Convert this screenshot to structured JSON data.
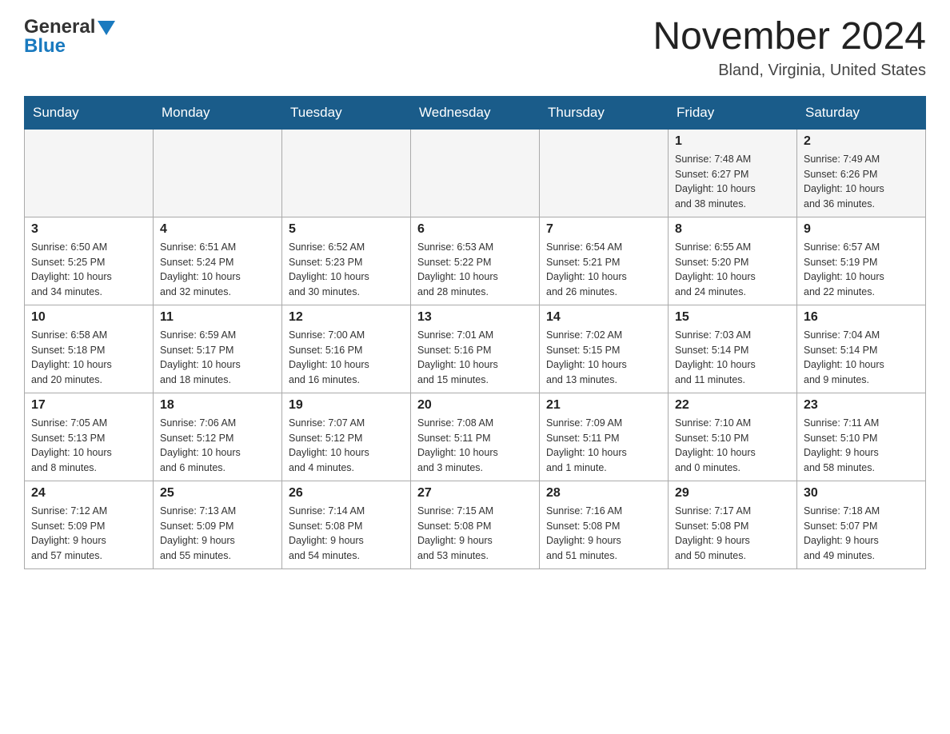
{
  "header": {
    "logo_line1": "General",
    "logo_line2": "Blue",
    "month_title": "November 2024",
    "location": "Bland, Virginia, United States"
  },
  "days_of_week": [
    "Sunday",
    "Monday",
    "Tuesday",
    "Wednesday",
    "Thursday",
    "Friday",
    "Saturday"
  ],
  "weeks": [
    [
      {
        "day": "",
        "info": ""
      },
      {
        "day": "",
        "info": ""
      },
      {
        "day": "",
        "info": ""
      },
      {
        "day": "",
        "info": ""
      },
      {
        "day": "",
        "info": ""
      },
      {
        "day": "1",
        "info": "Sunrise: 7:48 AM\nSunset: 6:27 PM\nDaylight: 10 hours\nand 38 minutes."
      },
      {
        "day": "2",
        "info": "Sunrise: 7:49 AM\nSunset: 6:26 PM\nDaylight: 10 hours\nand 36 minutes."
      }
    ],
    [
      {
        "day": "3",
        "info": "Sunrise: 6:50 AM\nSunset: 5:25 PM\nDaylight: 10 hours\nand 34 minutes."
      },
      {
        "day": "4",
        "info": "Sunrise: 6:51 AM\nSunset: 5:24 PM\nDaylight: 10 hours\nand 32 minutes."
      },
      {
        "day": "5",
        "info": "Sunrise: 6:52 AM\nSunset: 5:23 PM\nDaylight: 10 hours\nand 30 minutes."
      },
      {
        "day": "6",
        "info": "Sunrise: 6:53 AM\nSunset: 5:22 PM\nDaylight: 10 hours\nand 28 minutes."
      },
      {
        "day": "7",
        "info": "Sunrise: 6:54 AM\nSunset: 5:21 PM\nDaylight: 10 hours\nand 26 minutes."
      },
      {
        "day": "8",
        "info": "Sunrise: 6:55 AM\nSunset: 5:20 PM\nDaylight: 10 hours\nand 24 minutes."
      },
      {
        "day": "9",
        "info": "Sunrise: 6:57 AM\nSunset: 5:19 PM\nDaylight: 10 hours\nand 22 minutes."
      }
    ],
    [
      {
        "day": "10",
        "info": "Sunrise: 6:58 AM\nSunset: 5:18 PM\nDaylight: 10 hours\nand 20 minutes."
      },
      {
        "day": "11",
        "info": "Sunrise: 6:59 AM\nSunset: 5:17 PM\nDaylight: 10 hours\nand 18 minutes."
      },
      {
        "day": "12",
        "info": "Sunrise: 7:00 AM\nSunset: 5:16 PM\nDaylight: 10 hours\nand 16 minutes."
      },
      {
        "day": "13",
        "info": "Sunrise: 7:01 AM\nSunset: 5:16 PM\nDaylight: 10 hours\nand 15 minutes."
      },
      {
        "day": "14",
        "info": "Sunrise: 7:02 AM\nSunset: 5:15 PM\nDaylight: 10 hours\nand 13 minutes."
      },
      {
        "day": "15",
        "info": "Sunrise: 7:03 AM\nSunset: 5:14 PM\nDaylight: 10 hours\nand 11 minutes."
      },
      {
        "day": "16",
        "info": "Sunrise: 7:04 AM\nSunset: 5:14 PM\nDaylight: 10 hours\nand 9 minutes."
      }
    ],
    [
      {
        "day": "17",
        "info": "Sunrise: 7:05 AM\nSunset: 5:13 PM\nDaylight: 10 hours\nand 8 minutes."
      },
      {
        "day": "18",
        "info": "Sunrise: 7:06 AM\nSunset: 5:12 PM\nDaylight: 10 hours\nand 6 minutes."
      },
      {
        "day": "19",
        "info": "Sunrise: 7:07 AM\nSunset: 5:12 PM\nDaylight: 10 hours\nand 4 minutes."
      },
      {
        "day": "20",
        "info": "Sunrise: 7:08 AM\nSunset: 5:11 PM\nDaylight: 10 hours\nand 3 minutes."
      },
      {
        "day": "21",
        "info": "Sunrise: 7:09 AM\nSunset: 5:11 PM\nDaylight: 10 hours\nand 1 minute."
      },
      {
        "day": "22",
        "info": "Sunrise: 7:10 AM\nSunset: 5:10 PM\nDaylight: 10 hours\nand 0 minutes."
      },
      {
        "day": "23",
        "info": "Sunrise: 7:11 AM\nSunset: 5:10 PM\nDaylight: 9 hours\nand 58 minutes."
      }
    ],
    [
      {
        "day": "24",
        "info": "Sunrise: 7:12 AM\nSunset: 5:09 PM\nDaylight: 9 hours\nand 57 minutes."
      },
      {
        "day": "25",
        "info": "Sunrise: 7:13 AM\nSunset: 5:09 PM\nDaylight: 9 hours\nand 55 minutes."
      },
      {
        "day": "26",
        "info": "Sunrise: 7:14 AM\nSunset: 5:08 PM\nDaylight: 9 hours\nand 54 minutes."
      },
      {
        "day": "27",
        "info": "Sunrise: 7:15 AM\nSunset: 5:08 PM\nDaylight: 9 hours\nand 53 minutes."
      },
      {
        "day": "28",
        "info": "Sunrise: 7:16 AM\nSunset: 5:08 PM\nDaylight: 9 hours\nand 51 minutes."
      },
      {
        "day": "29",
        "info": "Sunrise: 7:17 AM\nSunset: 5:08 PM\nDaylight: 9 hours\nand 50 minutes."
      },
      {
        "day": "30",
        "info": "Sunrise: 7:18 AM\nSunset: 5:07 PM\nDaylight: 9 hours\nand 49 minutes."
      }
    ]
  ]
}
